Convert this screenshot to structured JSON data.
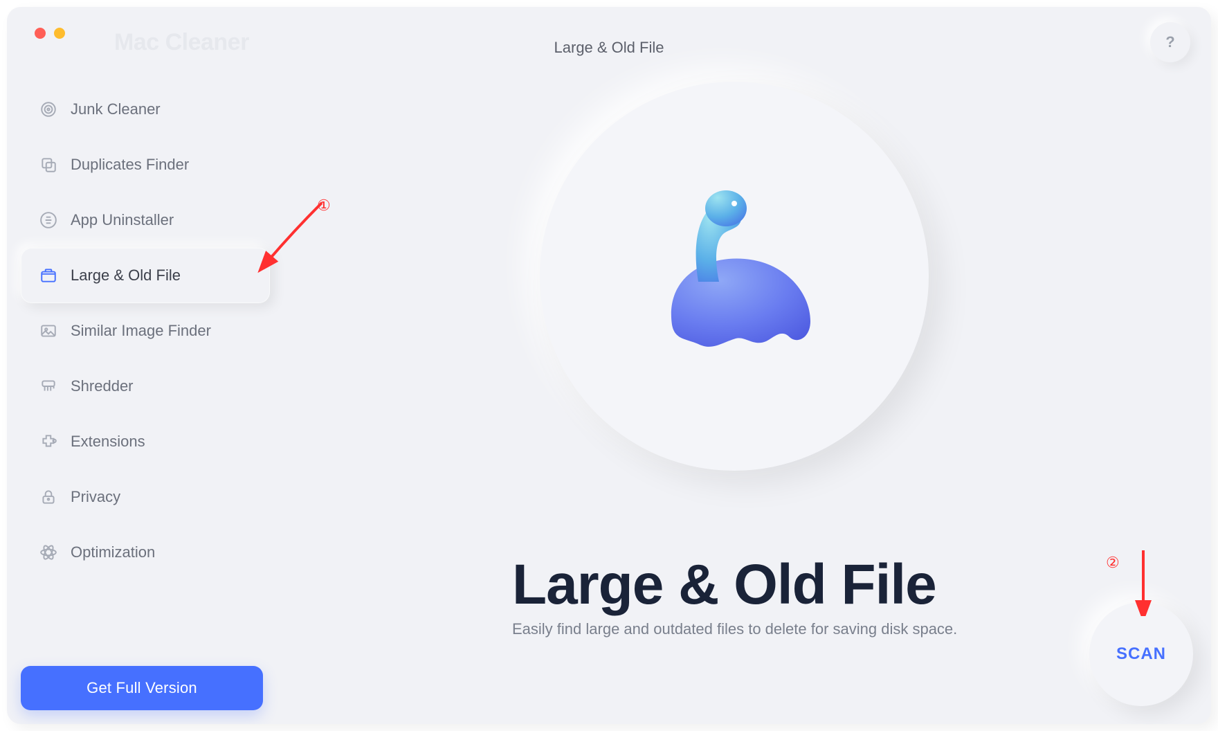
{
  "app": {
    "title": "Mac Cleaner"
  },
  "header": {
    "page_title": "Large & Old File",
    "help_label": "?"
  },
  "sidebar": {
    "items": [
      {
        "label": "Junk Cleaner",
        "icon": "target-icon"
      },
      {
        "label": "Duplicates Finder",
        "icon": "copy-icon"
      },
      {
        "label": "App Uninstaller",
        "icon": "app-badge-icon"
      },
      {
        "label": "Large & Old File",
        "icon": "folder-icon"
      },
      {
        "label": "Similar Image Finder",
        "icon": "image-icon"
      },
      {
        "label": "Shredder",
        "icon": "shredder-icon"
      },
      {
        "label": "Extensions",
        "icon": "puzzle-icon"
      },
      {
        "label": "Privacy",
        "icon": "lock-icon"
      },
      {
        "label": "Optimization",
        "icon": "atom-icon"
      }
    ],
    "active_index": 3
  },
  "main": {
    "heading": "Large & Old File",
    "subtitle": "Easily find large and outdated files to delete for saving disk space."
  },
  "buttons": {
    "get_full": "Get Full Version",
    "scan": "SCAN"
  },
  "annotations": {
    "one": "①",
    "two": "②"
  },
  "colors": {
    "accent": "#4670ff",
    "red": "#ff3030",
    "text_dark": "#1a2338",
    "text_muted": "#797f8c"
  }
}
